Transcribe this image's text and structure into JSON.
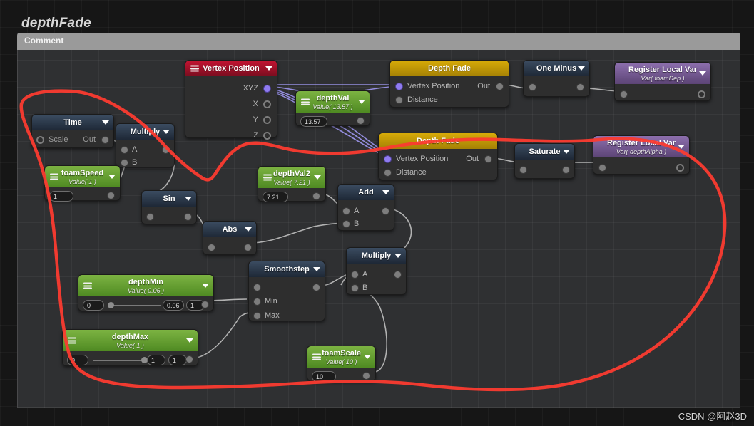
{
  "graph": {
    "title": "depthFade",
    "comment_label": "Comment",
    "watermark": "CSDN @阿赵3D"
  },
  "colors": {
    "header_red": "#c31432",
    "header_green": "#7cb342",
    "header_gold": "#d7ab08",
    "header_blue": "#3b4c61",
    "header_purple": "#8d6fae",
    "annotation_red": "#fb3b30",
    "vector_wire": "#9a93e8",
    "scalar_wire": "#c9c9c9",
    "node_body": "#2e2e2e",
    "comment_bar": "#9a9a9a"
  },
  "nodes": [
    {
      "id": "vertex-position",
      "title": "Vertex Position",
      "subtitle": "",
      "outputs": [
        "XYZ",
        "X",
        "Y",
        "Z"
      ],
      "inputs": []
    },
    {
      "id": "depth-val",
      "title": "depthVal",
      "subtitle": "Value( 13.57 )",
      "value": "13.57",
      "inputs": [],
      "outputs": []
    },
    {
      "id": "depth-fade-1",
      "title": "Depth Fade",
      "subtitle": "",
      "inputs": [
        "Vertex Position",
        "Distance"
      ],
      "outputs": [
        "Out"
      ]
    },
    {
      "id": "one-minus",
      "title": "One Minus",
      "subtitle": "",
      "inputs": [],
      "outputs": []
    },
    {
      "id": "register-local-var-1",
      "title": "Register Local Var",
      "subtitle": "Var( foamDep )",
      "inputs": [],
      "outputs": []
    },
    {
      "id": "time",
      "title": "Time",
      "subtitle": "",
      "inputs": [
        "Scale"
      ],
      "outputs": [
        "Out"
      ]
    },
    {
      "id": "multiply-1",
      "title": "Multiply",
      "subtitle": "",
      "inputs": [
        "A",
        "B"
      ],
      "outputs": []
    },
    {
      "id": "foam-speed",
      "title": "foamSpeed",
      "subtitle": "Value( 1 )",
      "value": "1",
      "inputs": [],
      "outputs": []
    },
    {
      "id": "depth-fade-2",
      "title": "Depth Fade",
      "subtitle": "",
      "inputs": [
        "Vertex Position",
        "Distance"
      ],
      "outputs": [
        "Out"
      ]
    },
    {
      "id": "saturate",
      "title": "Saturate",
      "subtitle": "",
      "inputs": [],
      "outputs": []
    },
    {
      "id": "register-local-var-2",
      "title": "Register Local Var",
      "subtitle": "Var( depthAlpha )",
      "inputs": [],
      "outputs": []
    },
    {
      "id": "depth-val2",
      "title": "depthVal2",
      "subtitle": "Value( 7.21 )",
      "value": "7.21",
      "inputs": [],
      "outputs": []
    },
    {
      "id": "sin",
      "title": "Sin",
      "subtitle": "",
      "inputs": [],
      "outputs": []
    },
    {
      "id": "add",
      "title": "Add",
      "subtitle": "",
      "inputs": [
        "A",
        "B"
      ],
      "outputs": []
    },
    {
      "id": "abs",
      "title": "Abs",
      "subtitle": "",
      "inputs": [],
      "outputs": []
    },
    {
      "id": "smoothstep",
      "title": "Smoothstep",
      "subtitle": "",
      "inputs": [
        "",
        "Min",
        "Max"
      ],
      "outputs": []
    },
    {
      "id": "multiply-2",
      "title": "Multiply",
      "subtitle": "",
      "inputs": [
        "A",
        "B"
      ],
      "outputs": []
    },
    {
      "id": "depth-min",
      "title": "depthMin",
      "subtitle": "Value( 0.06 )",
      "slider": {
        "min": "0",
        "value": "0.06",
        "max": "1",
        "knob_pct": 6
      }
    },
    {
      "id": "depth-max",
      "title": "depthMax",
      "subtitle": "Value( 1 )",
      "slider": {
        "min": "0",
        "value": "1",
        "max": "1",
        "knob_pct": 100
      }
    },
    {
      "id": "foam-scale",
      "title": "foamScale",
      "subtitle": "Value( 10 )",
      "value": "10"
    }
  ],
  "labels": {
    "vertex_position": "Vertex Position",
    "xyz": "XYZ",
    "x": "X",
    "y": "Y",
    "z": "Z",
    "depth_val": "depthVal",
    "depth_val_sub": "Value( 13.57 )",
    "depth_val_field": "13.57",
    "depth_fade": "Depth Fade",
    "vp_in": "Vertex Position",
    "distance": "Distance",
    "out": "Out",
    "one_minus": "One Minus",
    "register_local_var": "Register Local Var",
    "var_foam_dep": "Var( foamDep )",
    "var_depth_alpha": "Var( depthAlpha )",
    "time": "Time",
    "scale": "Scale",
    "multiply": "Multiply",
    "a": "A",
    "b": "B",
    "foam_speed": "foamSpeed",
    "foam_speed_sub": "Value( 1 )",
    "foam_speed_field": "1",
    "saturate": "Saturate",
    "depth_val2": "depthVal2",
    "depth_val2_sub": "Value( 7.21 )",
    "depth_val2_field": "7.21",
    "sin": "Sin",
    "add": "Add",
    "abs": "Abs",
    "smoothstep": "Smoothstep",
    "min": "Min",
    "max": "Max",
    "depth_min": "depthMin",
    "depth_min_sub": "Value( 0.06 )",
    "depth_min_lo": "0",
    "depth_min_val": "0.06",
    "depth_min_hi": "1",
    "depth_max": "depthMax",
    "depth_max_sub": "Value( 1 )",
    "depth_max_lo": "0",
    "depth_max_val": "1",
    "depth_max_hi": "1",
    "foam_scale": "foamScale",
    "foam_scale_sub": "Value( 10 )",
    "foam_scale_field": "10"
  }
}
